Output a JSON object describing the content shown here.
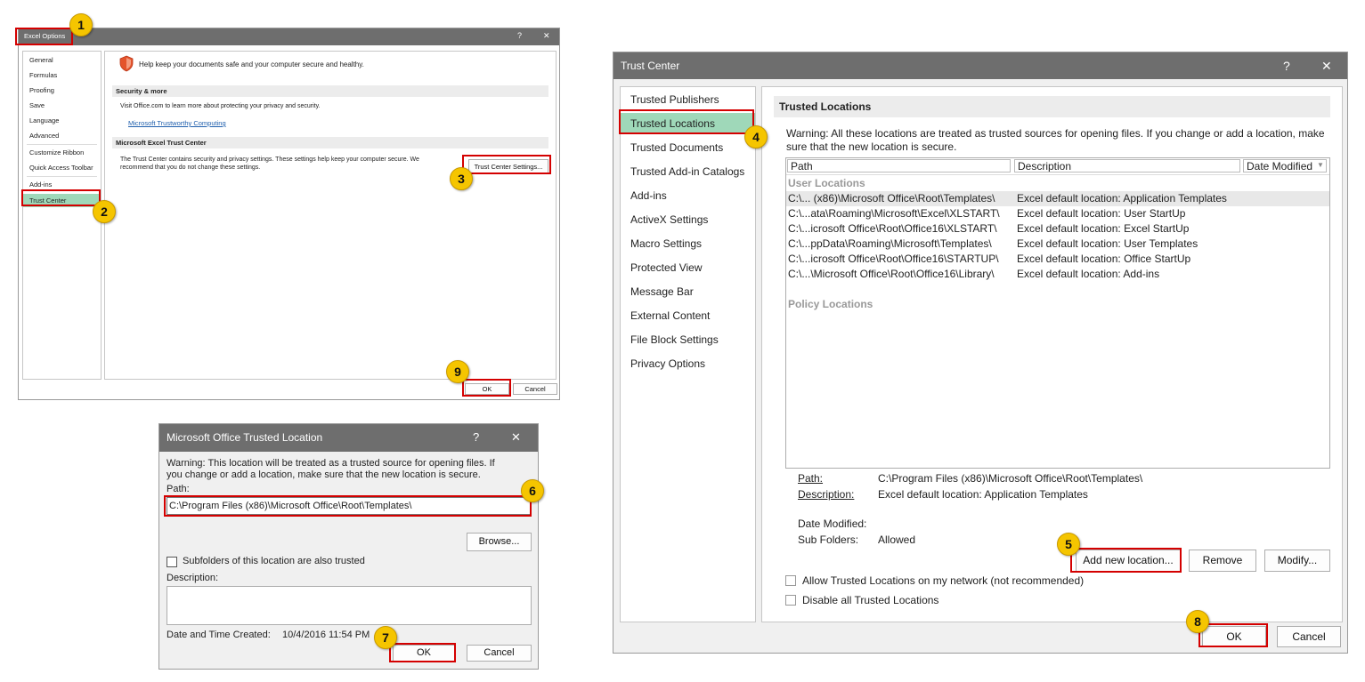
{
  "excel_options": {
    "title": "Excel Options",
    "help_glyph": "?",
    "close_glyph": "✕",
    "nav": [
      "General",
      "Formulas",
      "Proofing",
      "Save",
      "Language",
      "Advanced",
      "Customize Ribbon",
      "Quick Access Toolbar",
      "Add-ins",
      "Trust Center"
    ],
    "selected_nav": "Trust Center",
    "header_text": "Help keep your documents safe and your computer secure and healthy.",
    "section1_title": "Security & more",
    "section1_text": "Visit Office.com to learn more about protecting your privacy and security.",
    "section1_link": "Microsoft Trustworthy Computing",
    "section2_title": "Microsoft Excel Trust Center",
    "section2_text_line1": "The Trust Center contains security and privacy settings. These settings help keep your computer secure. We",
    "section2_text_line2": "recommend that you do not change these settings.",
    "trust_center_settings_button": "Trust Center Settings...",
    "ok_button": "OK",
    "cancel_button": "Cancel"
  },
  "trusted_location_dialog": {
    "title": "Microsoft Office Trusted Location",
    "help_glyph": "?",
    "close_glyph": "✕",
    "warning_line1": "Warning: This location will be treated as a trusted source for opening files. If",
    "warning_line2": "you change or add a location, make sure that the new location is secure.",
    "path_label": "Path:",
    "path_value": "C:\\Program Files (x86)\\Microsoft Office\\Root\\Templates\\",
    "browse_button": "Browse...",
    "subfolders_label": "Subfolders of this location are also trusted",
    "description_label": "Description:",
    "description_value": "",
    "date_created_label": "Date and Time Created:",
    "date_created_value": "10/4/2016 11:54 PM",
    "ok_button": "OK",
    "cancel_button": "Cancel"
  },
  "trust_center": {
    "title": "Trust Center",
    "help_glyph": "?",
    "close_glyph": "✕",
    "nav": [
      "Trusted Publishers",
      "Trusted Locations",
      "Trusted Documents",
      "Trusted Add-in Catalogs",
      "Add-ins",
      "ActiveX Settings",
      "Macro Settings",
      "Protected View",
      "Message Bar",
      "External Content",
      "File Block Settings",
      "Privacy Options"
    ],
    "selected_nav": "Trusted Locations",
    "section_title": "Trusted Locations",
    "warning_line1": "Warning: All these locations are treated as trusted sources for opening files.  If you change or add a location, make",
    "warning_line2": "sure that the new location is secure.",
    "columns": [
      "Path",
      "Description",
      "Date Modified"
    ],
    "user_locations_label": "User Locations",
    "user_locations": [
      {
        "path": "C:\\... (x86)\\Microsoft Office\\Root\\Templates\\",
        "description": "Excel default location: Application Templates"
      },
      {
        "path": "C:\\...ata\\Roaming\\Microsoft\\Excel\\XLSTART\\",
        "description": "Excel default location: User StartUp"
      },
      {
        "path": "C:\\...icrosoft Office\\Root\\Office16\\XLSTART\\",
        "description": "Excel default location: Excel StartUp"
      },
      {
        "path": "C:\\...ppData\\Roaming\\Microsoft\\Templates\\",
        "description": "Excel default location: User Templates"
      },
      {
        "path": "C:\\...icrosoft Office\\Root\\Office16\\STARTUP\\",
        "description": "Excel default location: Office StartUp"
      },
      {
        "path": "C:\\...\\Microsoft Office\\Root\\Office16\\Library\\",
        "description": "Excel default location: Add-ins"
      }
    ],
    "policy_locations_label": "Policy Locations",
    "details": {
      "path_label": "Path:",
      "path_value": "C:\\Program Files (x86)\\Microsoft Office\\Root\\Templates\\",
      "description_label": "Description:",
      "description_value": "Excel default location: Application Templates",
      "date_modified_label": "Date Modified:",
      "date_modified_value": "",
      "sub_folders_label": "Sub Folders:",
      "sub_folders_value": "Allowed"
    },
    "add_button": "Add new location...",
    "remove_button": "Remove",
    "modify_button": "Modify...",
    "allow_network_label": "Allow Trusted Locations on my network (not recommended)",
    "disable_all_label": "Disable all Trusted Locations",
    "ok_button": "OK",
    "cancel_button": "Cancel"
  },
  "steps": [
    "1",
    "2",
    "3",
    "4",
    "5",
    "6",
    "7",
    "8",
    "9"
  ],
  "colors": {
    "accent": "#9fd8b9",
    "highlight": "#d40000",
    "badge": "#f5c500",
    "titlebar": "#6e6e6e"
  }
}
